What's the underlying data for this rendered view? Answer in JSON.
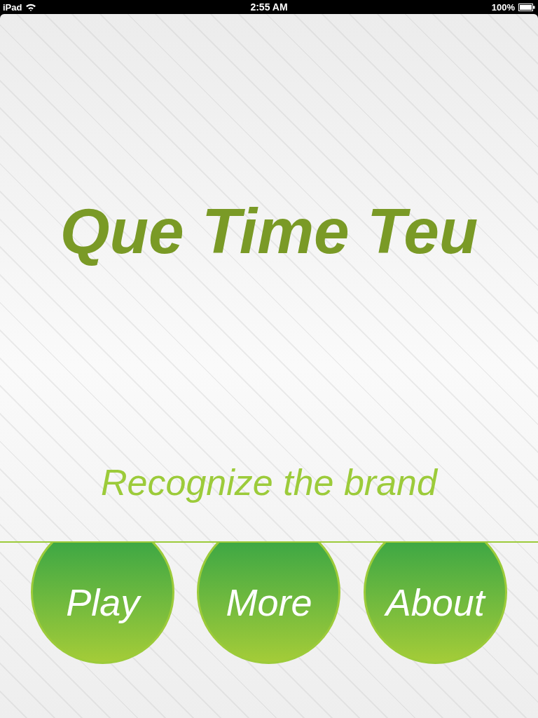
{
  "status_bar": {
    "device": "iPad",
    "time": "2:55 AM",
    "battery": "100%"
  },
  "title": "Que Time Teu",
  "subtitle": "Recognize the brand",
  "buttons": [
    {
      "label": "Play"
    },
    {
      "label": "More"
    },
    {
      "label": "About"
    }
  ]
}
